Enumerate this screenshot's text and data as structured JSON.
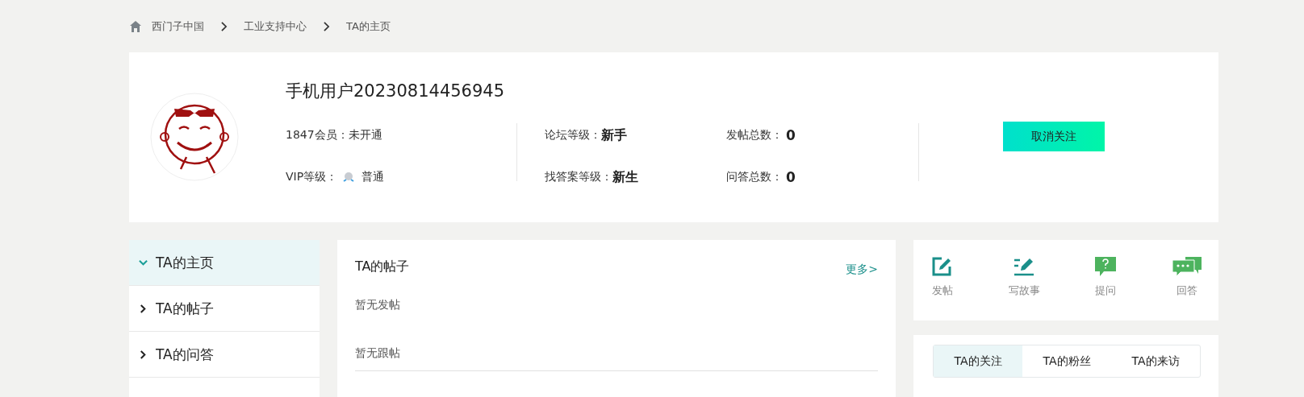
{
  "breadcrumb": [
    "西门子中国",
    "工业支持中心",
    "TA的主页"
  ],
  "profile": {
    "name": "手机用户20230814456945",
    "membership": {
      "label": "1847会员：",
      "value": "未开通"
    },
    "vip": {
      "label": "VIP等级：",
      "value": "普通"
    },
    "levels": [
      {
        "label": "论坛等级：",
        "value": "新手"
      },
      {
        "label": "找答案等级：",
        "value": "新生"
      }
    ],
    "totals": [
      {
        "label": "发帖总数：",
        "value": "0"
      },
      {
        "label": "问答总数：",
        "value": "0"
      }
    ],
    "button": "取消关注"
  },
  "menu": [
    {
      "label": "TA的主页",
      "selected": true
    },
    {
      "label": "TA的帖子",
      "selected": false
    },
    {
      "label": "TA的问答",
      "selected": false
    }
  ],
  "posts": {
    "title": "TA的帖子",
    "more": "更多>",
    "sections": [
      "暂无发帖",
      "暂无跟帖"
    ]
  },
  "actions": [
    {
      "kind": "post",
      "label": "发帖"
    },
    {
      "kind": "story",
      "label": "写故事"
    },
    {
      "kind": "ask",
      "label": "提问"
    },
    {
      "kind": "answer",
      "label": "回答"
    }
  ],
  "tabs": [
    {
      "label": "TA的关注",
      "selected": true
    },
    {
      "label": "TA的粉丝",
      "selected": false
    },
    {
      "label": "TA的来访",
      "selected": false
    }
  ]
}
